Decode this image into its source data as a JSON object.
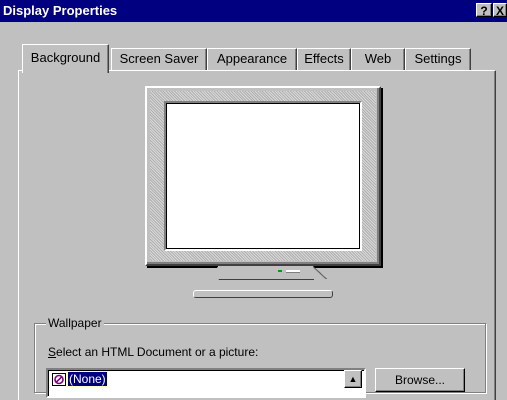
{
  "window": {
    "title": "Display Properties",
    "help_button": "?",
    "close_button": "X"
  },
  "tabs": [
    {
      "label": "Background",
      "active": true
    },
    {
      "label": "Screen Saver",
      "active": false
    },
    {
      "label": "Appearance",
      "active": false
    },
    {
      "label": "Effects",
      "active": false
    },
    {
      "label": "Web",
      "active": false
    },
    {
      "label": "Settings",
      "active": false
    }
  ],
  "wallpaper": {
    "group_label": "Wallpaper",
    "prompt_underlined": "S",
    "prompt_rest": "elect an HTML Document or a picture:",
    "selected_item": "(None)",
    "selected_icon": "none-wallpaper-icon",
    "browse_label": "Browse..."
  },
  "colors": {
    "titlebar": "#000080",
    "face": "#c0c0c0",
    "selection": "#000080"
  }
}
